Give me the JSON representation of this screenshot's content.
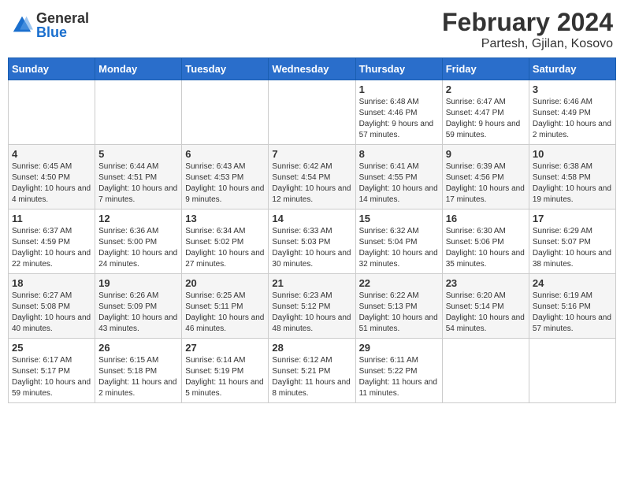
{
  "header": {
    "logo": {
      "general": "General",
      "blue": "Blue"
    },
    "title": "February 2024",
    "subtitle": "Partesh, Gjilan, Kosovo"
  },
  "columns": [
    "Sunday",
    "Monday",
    "Tuesday",
    "Wednesday",
    "Thursday",
    "Friday",
    "Saturday"
  ],
  "weeks": [
    [
      {
        "day": "",
        "sunrise": "",
        "sunset": "",
        "daylight": ""
      },
      {
        "day": "",
        "sunrise": "",
        "sunset": "",
        "daylight": ""
      },
      {
        "day": "",
        "sunrise": "",
        "sunset": "",
        "daylight": ""
      },
      {
        "day": "",
        "sunrise": "",
        "sunset": "",
        "daylight": ""
      },
      {
        "day": "1",
        "sunrise": "Sunrise: 6:48 AM",
        "sunset": "Sunset: 4:46 PM",
        "daylight": "Daylight: 9 hours and 57 minutes."
      },
      {
        "day": "2",
        "sunrise": "Sunrise: 6:47 AM",
        "sunset": "Sunset: 4:47 PM",
        "daylight": "Daylight: 9 hours and 59 minutes."
      },
      {
        "day": "3",
        "sunrise": "Sunrise: 6:46 AM",
        "sunset": "Sunset: 4:49 PM",
        "daylight": "Daylight: 10 hours and 2 minutes."
      }
    ],
    [
      {
        "day": "4",
        "sunrise": "Sunrise: 6:45 AM",
        "sunset": "Sunset: 4:50 PM",
        "daylight": "Daylight: 10 hours and 4 minutes."
      },
      {
        "day": "5",
        "sunrise": "Sunrise: 6:44 AM",
        "sunset": "Sunset: 4:51 PM",
        "daylight": "Daylight: 10 hours and 7 minutes."
      },
      {
        "day": "6",
        "sunrise": "Sunrise: 6:43 AM",
        "sunset": "Sunset: 4:53 PM",
        "daylight": "Daylight: 10 hours and 9 minutes."
      },
      {
        "day": "7",
        "sunrise": "Sunrise: 6:42 AM",
        "sunset": "Sunset: 4:54 PM",
        "daylight": "Daylight: 10 hours and 12 minutes."
      },
      {
        "day": "8",
        "sunrise": "Sunrise: 6:41 AM",
        "sunset": "Sunset: 4:55 PM",
        "daylight": "Daylight: 10 hours and 14 minutes."
      },
      {
        "day": "9",
        "sunrise": "Sunrise: 6:39 AM",
        "sunset": "Sunset: 4:56 PM",
        "daylight": "Daylight: 10 hours and 17 minutes."
      },
      {
        "day": "10",
        "sunrise": "Sunrise: 6:38 AM",
        "sunset": "Sunset: 4:58 PM",
        "daylight": "Daylight: 10 hours and 19 minutes."
      }
    ],
    [
      {
        "day": "11",
        "sunrise": "Sunrise: 6:37 AM",
        "sunset": "Sunset: 4:59 PM",
        "daylight": "Daylight: 10 hours and 22 minutes."
      },
      {
        "day": "12",
        "sunrise": "Sunrise: 6:36 AM",
        "sunset": "Sunset: 5:00 PM",
        "daylight": "Daylight: 10 hours and 24 minutes."
      },
      {
        "day": "13",
        "sunrise": "Sunrise: 6:34 AM",
        "sunset": "Sunset: 5:02 PM",
        "daylight": "Daylight: 10 hours and 27 minutes."
      },
      {
        "day": "14",
        "sunrise": "Sunrise: 6:33 AM",
        "sunset": "Sunset: 5:03 PM",
        "daylight": "Daylight: 10 hours and 30 minutes."
      },
      {
        "day": "15",
        "sunrise": "Sunrise: 6:32 AM",
        "sunset": "Sunset: 5:04 PM",
        "daylight": "Daylight: 10 hours and 32 minutes."
      },
      {
        "day": "16",
        "sunrise": "Sunrise: 6:30 AM",
        "sunset": "Sunset: 5:06 PM",
        "daylight": "Daylight: 10 hours and 35 minutes."
      },
      {
        "day": "17",
        "sunrise": "Sunrise: 6:29 AM",
        "sunset": "Sunset: 5:07 PM",
        "daylight": "Daylight: 10 hours and 38 minutes."
      }
    ],
    [
      {
        "day": "18",
        "sunrise": "Sunrise: 6:27 AM",
        "sunset": "Sunset: 5:08 PM",
        "daylight": "Daylight: 10 hours and 40 minutes."
      },
      {
        "day": "19",
        "sunrise": "Sunrise: 6:26 AM",
        "sunset": "Sunset: 5:09 PM",
        "daylight": "Daylight: 10 hours and 43 minutes."
      },
      {
        "day": "20",
        "sunrise": "Sunrise: 6:25 AM",
        "sunset": "Sunset: 5:11 PM",
        "daylight": "Daylight: 10 hours and 46 minutes."
      },
      {
        "day": "21",
        "sunrise": "Sunrise: 6:23 AM",
        "sunset": "Sunset: 5:12 PM",
        "daylight": "Daylight: 10 hours and 48 minutes."
      },
      {
        "day": "22",
        "sunrise": "Sunrise: 6:22 AM",
        "sunset": "Sunset: 5:13 PM",
        "daylight": "Daylight: 10 hours and 51 minutes."
      },
      {
        "day": "23",
        "sunrise": "Sunrise: 6:20 AM",
        "sunset": "Sunset: 5:14 PM",
        "daylight": "Daylight: 10 hours and 54 minutes."
      },
      {
        "day": "24",
        "sunrise": "Sunrise: 6:19 AM",
        "sunset": "Sunset: 5:16 PM",
        "daylight": "Daylight: 10 hours and 57 minutes."
      }
    ],
    [
      {
        "day": "25",
        "sunrise": "Sunrise: 6:17 AM",
        "sunset": "Sunset: 5:17 PM",
        "daylight": "Daylight: 10 hours and 59 minutes."
      },
      {
        "day": "26",
        "sunrise": "Sunrise: 6:15 AM",
        "sunset": "Sunset: 5:18 PM",
        "daylight": "Daylight: 11 hours and 2 minutes."
      },
      {
        "day": "27",
        "sunrise": "Sunrise: 6:14 AM",
        "sunset": "Sunset: 5:19 PM",
        "daylight": "Daylight: 11 hours and 5 minutes."
      },
      {
        "day": "28",
        "sunrise": "Sunrise: 6:12 AM",
        "sunset": "Sunset: 5:21 PM",
        "daylight": "Daylight: 11 hours and 8 minutes."
      },
      {
        "day": "29",
        "sunrise": "Sunrise: 6:11 AM",
        "sunset": "Sunset: 5:22 PM",
        "daylight": "Daylight: 11 hours and 11 minutes."
      },
      {
        "day": "",
        "sunrise": "",
        "sunset": "",
        "daylight": ""
      },
      {
        "day": "",
        "sunrise": "",
        "sunset": "",
        "daylight": ""
      }
    ]
  ]
}
